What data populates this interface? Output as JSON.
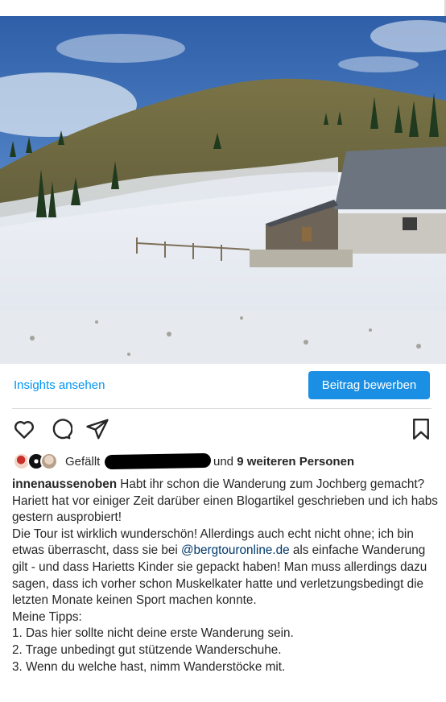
{
  "insights": {
    "link_label": "Insights ansehen",
    "promote_label": "Beitrag bewerben"
  },
  "actions": {
    "like_icon": "heart-icon",
    "comment_icon": "comment-icon",
    "share_icon": "paper-plane-icon",
    "save_icon": "bookmark-icon"
  },
  "likes": {
    "prefix": "Gefällt",
    "suffix": "und",
    "others": "9 weiteren Personen"
  },
  "caption": {
    "username": "innenaussenoben",
    "line1": "Habt ihr schon die Wanderung zum Jochberg gemacht?",
    "line2": "Hariett hat vor einiger Zeit darüber einen Blogartikel geschrieben und ich habs gestern ausprobiert!",
    "line3_before": "Die Tour ist wirklich wunderschön! Allerdings auch echt nicht ohne; ich bin etwas überrascht, dass sie bei ",
    "mention": "@bergtouronline.de",
    "line3_after": " als einfache Wanderung gilt - und dass Harietts Kinder sie gepackt haben! Man muss allerdings dazu sagen, dass ich vorher schon Muskelkater hatte und verletzungsbedingt die letzten Monate keinen Sport machen konnte.",
    "tips_title": "Meine Tipps:",
    "tip1": "1. Das hier sollte nicht deine erste Wanderung sein.",
    "tip2": "2. Trage unbedingt gut stützende Wanderschuhe.",
    "tip3": "3. Wenn du welche hast, nimm Wanderstöcke mit."
  },
  "colors": {
    "accent": "#0095f6",
    "button": "#1a8fe3",
    "mention": "#00376b",
    "text": "#262626"
  }
}
